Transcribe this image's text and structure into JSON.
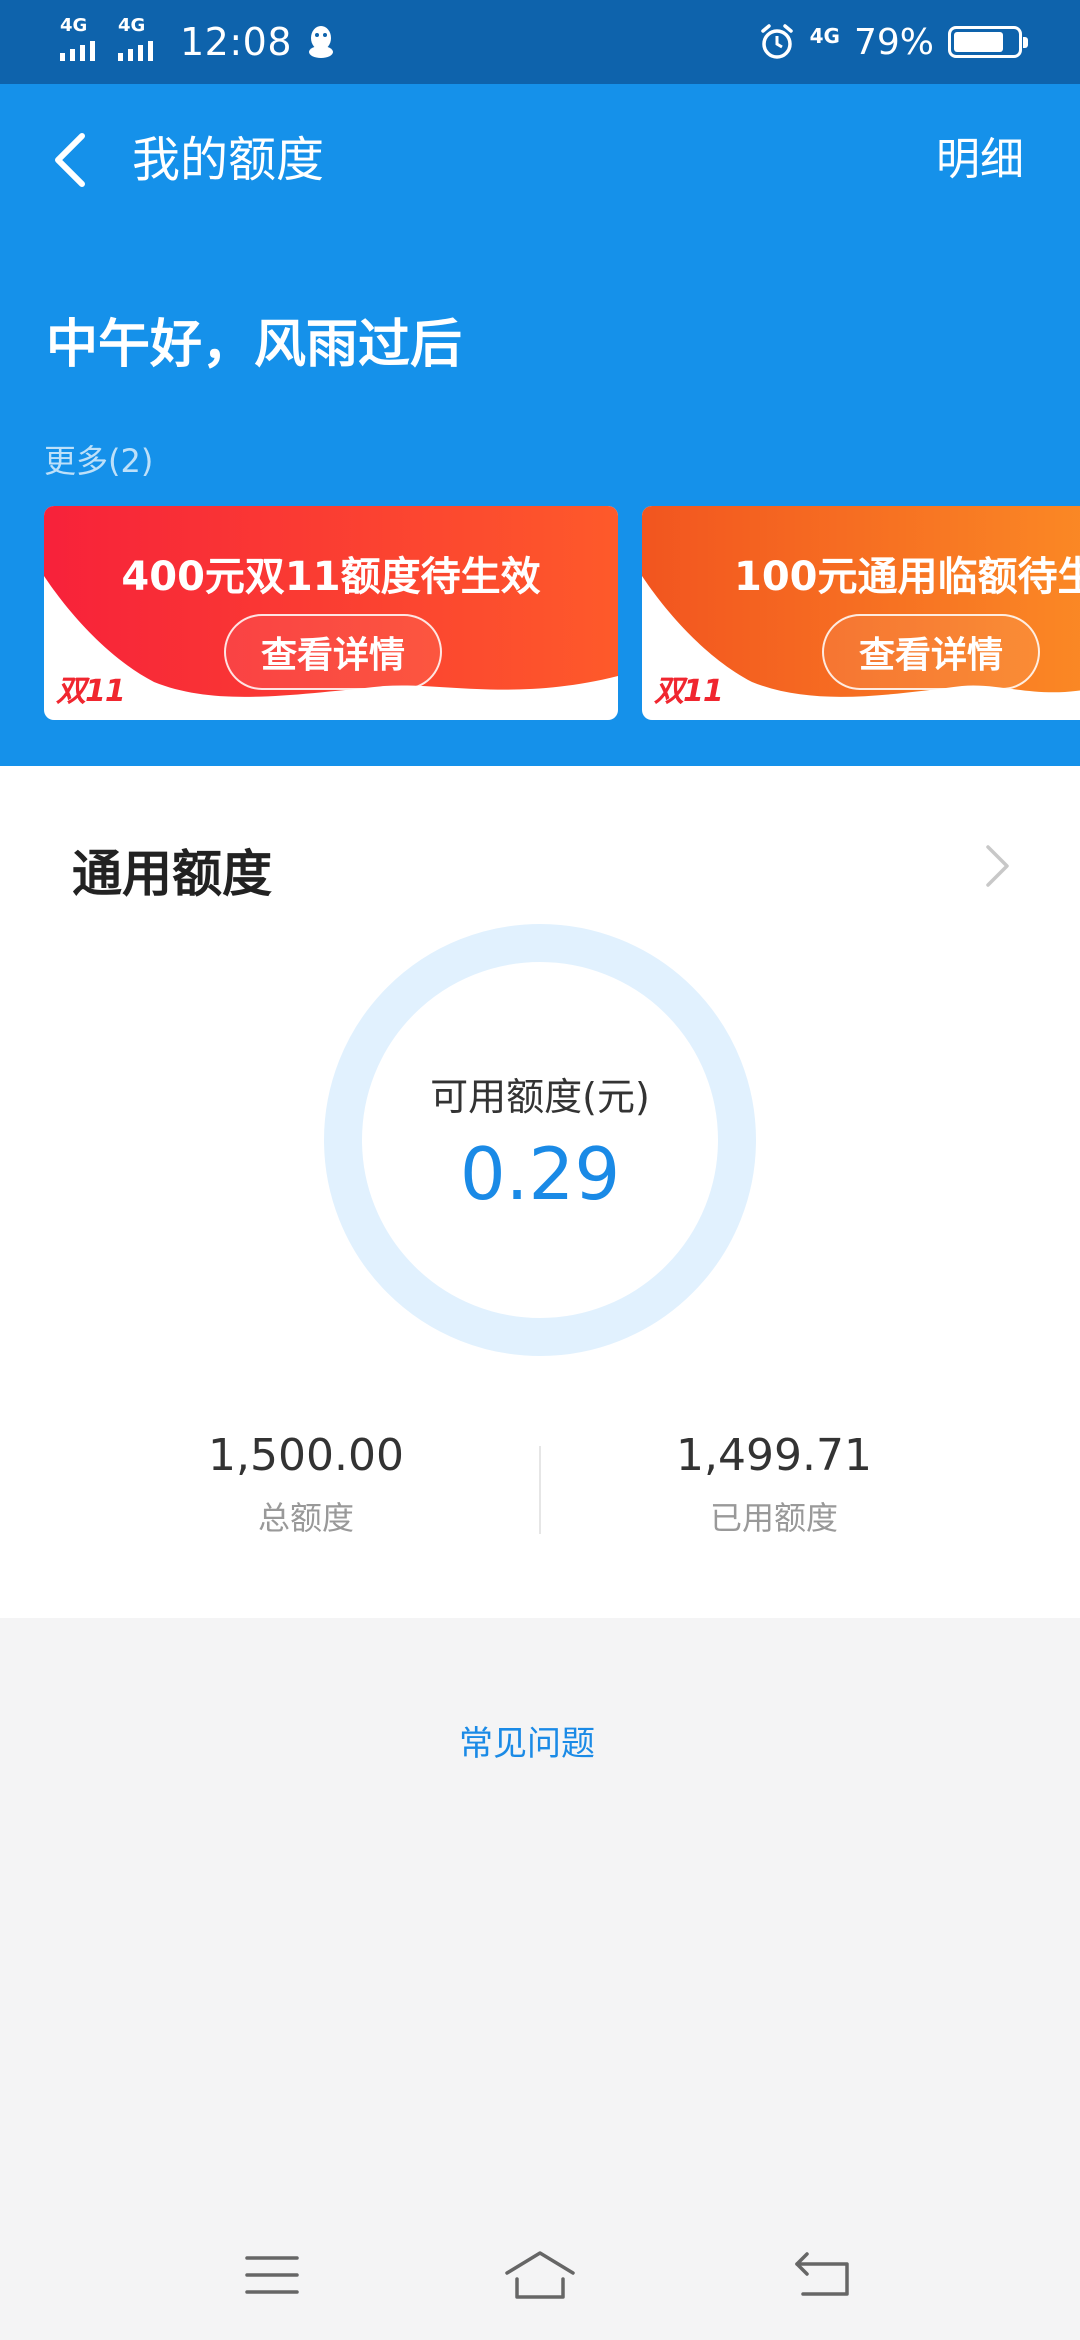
{
  "status_bar": {
    "sim1": "4G",
    "sim2": "4G",
    "time": "12:08",
    "network": "4G",
    "battery": "79%",
    "battery_level": 0.79
  },
  "header": {
    "title": "我的额度",
    "detail_label": "明细",
    "greeting": "中午好，风雨过后",
    "more_label": "更多(2)"
  },
  "promos": [
    {
      "title": "400元双11额度待生效",
      "button": "查看详情",
      "logo": "双11"
    },
    {
      "title": "100元通用临额待生",
      "button": "查看详情",
      "logo": "双11"
    }
  ],
  "credit": {
    "section_title": "通用额度",
    "available_label": "可用额度(元)",
    "available_value": "0.29",
    "total_value": "1,500.00",
    "total_label": "总额度",
    "used_value": "1,499.71",
    "used_label": "已用额度"
  },
  "faq_label": "常见问题",
  "colors": {
    "status_bar": "#0e63ac",
    "header": "#1591ea",
    "accent": "#1a8ae6",
    "promo_red": "#f0262f",
    "promo_orange": "#f66a1d"
  }
}
